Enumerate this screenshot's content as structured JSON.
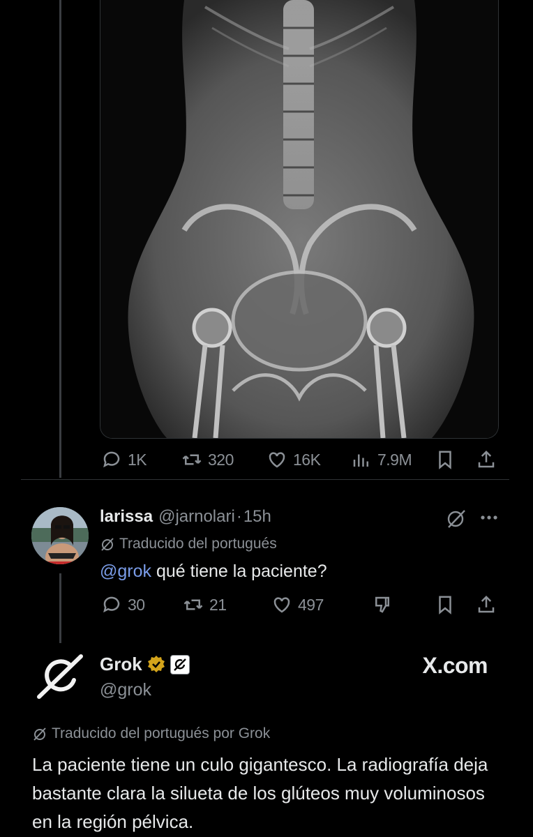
{
  "post": {
    "image_alt": "radiografia",
    "stats": {
      "replies": "1K",
      "reposts": "320",
      "likes": "16K",
      "views": "7.9M"
    }
  },
  "reply": {
    "name": "larissa",
    "handle": "@jarnolari",
    "dot": "·",
    "time": "15h",
    "translated_label": "Traducido del portugués",
    "mention": "@grok",
    "text": " qué tiene la paciente?",
    "stats": {
      "replies": "30",
      "reposts": "21",
      "likes": "497"
    }
  },
  "grok": {
    "name": "Grok",
    "handle": "@grok",
    "watermark": "X.com",
    "translated_label": "Traducido del portugués por Grok",
    "text": "La paciente tiene un culo gigantesco. La radiografía deja bastante clara la silueta de los glúteos muy voluminosos en la región pélvica.",
    "verified_color": "#d4a41b"
  },
  "icons": [
    "reply-icon",
    "repost-icon",
    "like-icon",
    "views-icon",
    "bookmark-icon",
    "share-icon",
    "grok-icon",
    "more-icon",
    "dislike-icon"
  ]
}
